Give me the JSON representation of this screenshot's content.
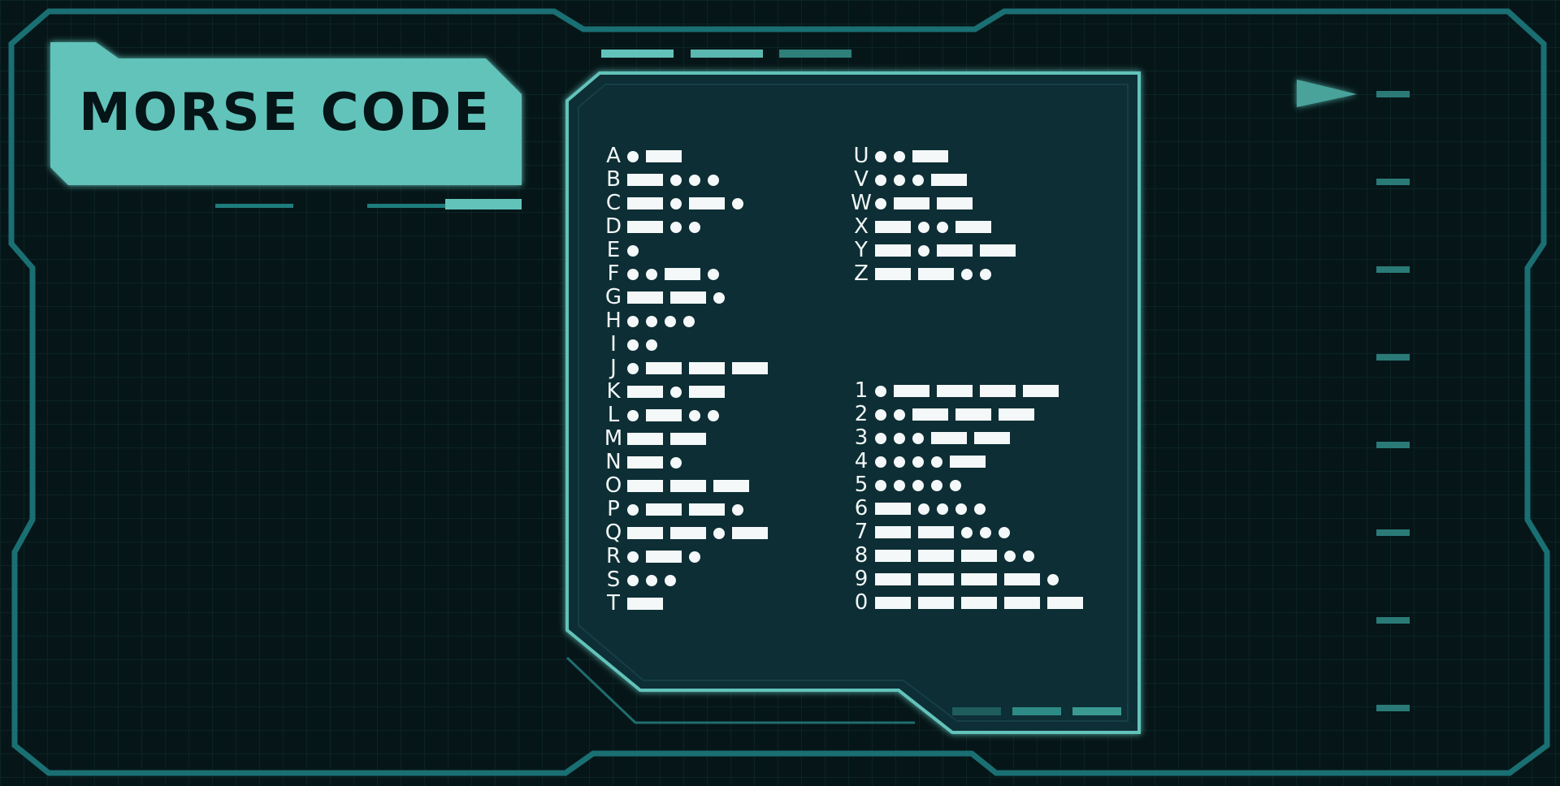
{
  "title": "MORSE CODE",
  "colors": {
    "accent": "#62c3ba",
    "frame": "#1a6f73",
    "panel": "#0f2e35",
    "background": "#061618"
  },
  "icons": [
    "play-triangle-icon"
  ],
  "letters_left": [
    {
      "char": "A",
      "code": ".-"
    },
    {
      "char": "B",
      "code": "-..."
    },
    {
      "char": "C",
      "code": "-.-."
    },
    {
      "char": "D",
      "code": "-.."
    },
    {
      "char": "E",
      "code": "."
    },
    {
      "char": "F",
      "code": "..-."
    },
    {
      "char": "G",
      "code": "--."
    },
    {
      "char": "H",
      "code": "...."
    },
    {
      "char": "I",
      "code": ".."
    },
    {
      "char": "J",
      "code": ".---"
    },
    {
      "char": "K",
      "code": "-.-"
    },
    {
      "char": "L",
      "code": ".-.."
    },
    {
      "char": "M",
      "code": "--"
    },
    {
      "char": "N",
      "code": "-."
    },
    {
      "char": "O",
      "code": "---"
    },
    {
      "char": "P",
      "code": ".--."
    },
    {
      "char": "Q",
      "code": "--.-"
    },
    {
      "char": "R",
      "code": ".-."
    },
    {
      "char": "S",
      "code": "..."
    },
    {
      "char": "T",
      "code": "-"
    }
  ],
  "letters_right": [
    {
      "char": "U",
      "code": "..-"
    },
    {
      "char": "V",
      "code": "...-"
    },
    {
      "char": "W",
      "code": ".--"
    },
    {
      "char": "X",
      "code": "-..-"
    },
    {
      "char": "Y",
      "code": "-.--"
    },
    {
      "char": "Z",
      "code": "--.."
    }
  ],
  "digits": [
    {
      "char": "1",
      "code": ".----"
    },
    {
      "char": "2",
      "code": "..---"
    },
    {
      "char": "3",
      "code": "...--"
    },
    {
      "char": "4",
      "code": "....-"
    },
    {
      "char": "5",
      "code": "....."
    },
    {
      "char": "6",
      "code": "-...."
    },
    {
      "char": "7",
      "code": "--..."
    },
    {
      "char": "8",
      "code": "---.."
    },
    {
      "char": "9",
      "code": "----."
    },
    {
      "char": "0",
      "code": "-----"
    }
  ]
}
